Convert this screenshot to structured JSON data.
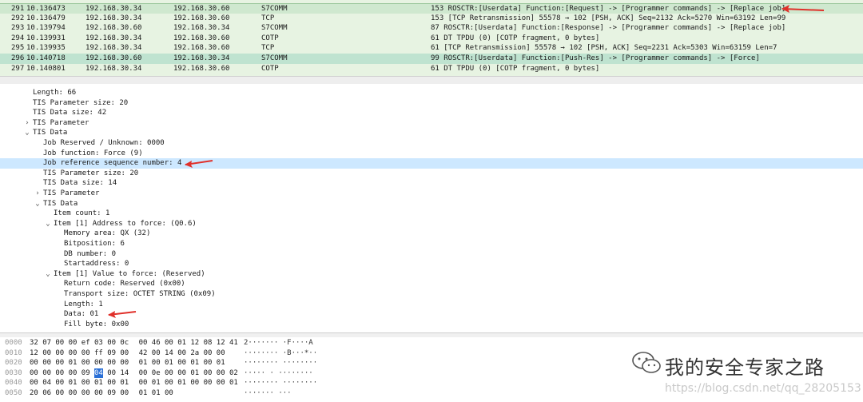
{
  "packet_list": {
    "rows": [
      {
        "no": "291",
        "time": "10.136473",
        "src": "192.168.30.34",
        "dst": "192.168.30.60",
        "proto": "S7COMM",
        "info": "153 ROSCTR:[Userdata] Function:[Request] -> [Programmer commands] -> [Replace job]",
        "bg": "#cfe8cf",
        "selected": true
      },
      {
        "no": "292",
        "time": "10.136479",
        "src": "192.168.30.34",
        "dst": "192.168.30.60",
        "proto": "TCP",
        "info": "153 [TCP Retransmission] 55578 → 102 [PSH, ACK] Seq=2132 Ack=5270 Win=63192 Len=99",
        "bg": "#e7f3e2"
      },
      {
        "no": "293",
        "time": "10.139794",
        "src": "192.168.30.60",
        "dst": "192.168.30.34",
        "proto": "S7COMM",
        "info": "87 ROSCTR:[Userdata] Function:[Response] -> [Programmer commands] -> [Replace job]",
        "bg": "#e7f3e2"
      },
      {
        "no": "294",
        "time": "10.139931",
        "src": "192.168.30.34",
        "dst": "192.168.30.60",
        "proto": "COTP",
        "info": "61 DT TPDU (0) [COTP fragment, 0 bytes]",
        "bg": "#e7f3e2"
      },
      {
        "no": "295",
        "time": "10.139935",
        "src": "192.168.30.34",
        "dst": "192.168.30.60",
        "proto": "TCP",
        "info": "61 [TCP Retransmission] 55578 → 102 [PSH, ACK] Seq=2231 Ack=5303 Win=63159 Len=7",
        "bg": "#e7f3e2"
      },
      {
        "no": "296",
        "time": "10.140718",
        "src": "192.168.30.60",
        "dst": "192.168.30.34",
        "proto": "S7COMM",
        "info": "99 ROSCTR:[Userdata] Function:[Push-Res] -> [Programmer commands] -> [Force]",
        "bg": "#bfe3d0"
      },
      {
        "no": "297",
        "time": "10.140801",
        "src": "192.168.30.34",
        "dst": "192.168.30.60",
        "proto": "COTP",
        "info": "61 DT TPDU (0) [COTP fragment, 0 bytes]",
        "bg": "#e7f3e2"
      }
    ]
  },
  "detail_tree": {
    "rows": [
      {
        "indent": 0,
        "tw": "",
        "text": "Length: 66"
      },
      {
        "indent": 0,
        "tw": "",
        "text": "TIS Parameter size: 20"
      },
      {
        "indent": 0,
        "tw": "",
        "text": "TIS Data size: 42"
      },
      {
        "indent": 0,
        "tw": "›",
        "text": "TIS Parameter"
      },
      {
        "indent": 0,
        "tw": "⌄",
        "text": "TIS Data"
      },
      {
        "indent": 1,
        "tw": "",
        "text": "Job Reserved / Unknown: 0000"
      },
      {
        "indent": 1,
        "tw": "",
        "text": "Job function: Force (9)"
      },
      {
        "indent": 1,
        "tw": "",
        "text": "Job reference sequence number: 4",
        "highlight": true
      },
      {
        "indent": 1,
        "tw": "",
        "text": "TIS Parameter size: 20"
      },
      {
        "indent": 1,
        "tw": "",
        "text": "TIS Data size: 14"
      },
      {
        "indent": 1,
        "tw": "›",
        "text": "TIS Parameter"
      },
      {
        "indent": 1,
        "tw": "⌄",
        "text": "TIS Data"
      },
      {
        "indent": 2,
        "tw": "",
        "text": "Item count: 1"
      },
      {
        "indent": 2,
        "tw": "⌄",
        "text": "Item [1] Address to force: (Q0.6)"
      },
      {
        "indent": 3,
        "tw": "",
        "text": "Memory area: QX (32)"
      },
      {
        "indent": 3,
        "tw": "",
        "text": "Bitposition: 6"
      },
      {
        "indent": 3,
        "tw": "",
        "text": "DB number: 0"
      },
      {
        "indent": 3,
        "tw": "",
        "text": "Startaddress: 0"
      },
      {
        "indent": 2,
        "tw": "⌄",
        "text": "Item [1] Value to force: (Reserved)"
      },
      {
        "indent": 3,
        "tw": "",
        "text": "Return code: Reserved (0x00)"
      },
      {
        "indent": 3,
        "tw": "",
        "text": "Transport size: OCTET STRING (0x09)"
      },
      {
        "indent": 3,
        "tw": "",
        "text": "Length: 1"
      },
      {
        "indent": 3,
        "tw": "",
        "text": "Data: 01"
      },
      {
        "indent": 3,
        "tw": "",
        "text": "Fill byte: 0x00"
      }
    ]
  },
  "hex_dump": {
    "rows": [
      {
        "offset": "0000",
        "bytes": [
          "32",
          "07",
          "00",
          "00",
          "ef",
          "03",
          "00",
          "0c",
          "00",
          "46",
          "00",
          "01",
          "12",
          "08",
          "12",
          "41"
        ],
        "ascii": "2·······  ·F····A"
      },
      {
        "offset": "0010",
        "bytes": [
          "12",
          "00",
          "00",
          "00",
          "00",
          "ff",
          "09",
          "00",
          "42",
          "00",
          "14",
          "00",
          "2a",
          "00",
          "00"
        ],
        "ascii": "········  ·B···*··"
      },
      {
        "offset": "0020",
        "bytes": [
          "00",
          "00",
          "00",
          "01",
          "00",
          "00",
          "00",
          "00",
          "01",
          "00",
          "01",
          "00",
          "01",
          "00",
          "01"
        ],
        "ascii": "········  ········"
      },
      {
        "offset": "0030",
        "bytes": [
          "00",
          "00",
          "00",
          "00",
          "09",
          "04",
          "00",
          "14",
          "00",
          "0e",
          "00",
          "00",
          "01",
          "00",
          "00",
          "02"
        ],
        "ascii": "·····  ·  ········",
        "sel_index": 5
      },
      {
        "offset": "0040",
        "bytes": [
          "00",
          "04",
          "00",
          "01",
          "00",
          "01",
          "00",
          "01",
          "00",
          "01",
          "00",
          "01",
          "00",
          "00",
          "00",
          "01"
        ],
        "ascii": "········  ········"
      },
      {
        "offset": "0050",
        "bytes": [
          "20",
          "06",
          "00",
          "00",
          "00",
          "00",
          "09",
          "00",
          "01",
          "01",
          "00"
        ],
        "ascii": " ·······  ···"
      }
    ]
  },
  "watermark": {
    "title": "我的安全专家之路",
    "url": "https://blog.csdn.net/qq_28205153",
    "icon": "wechat-icon"
  },
  "annotations": {
    "arrow_color": "#e0302a",
    "arrows": [
      "arrow-replace-job",
      "arrow-job-reference",
      "arrow-data"
    ]
  }
}
